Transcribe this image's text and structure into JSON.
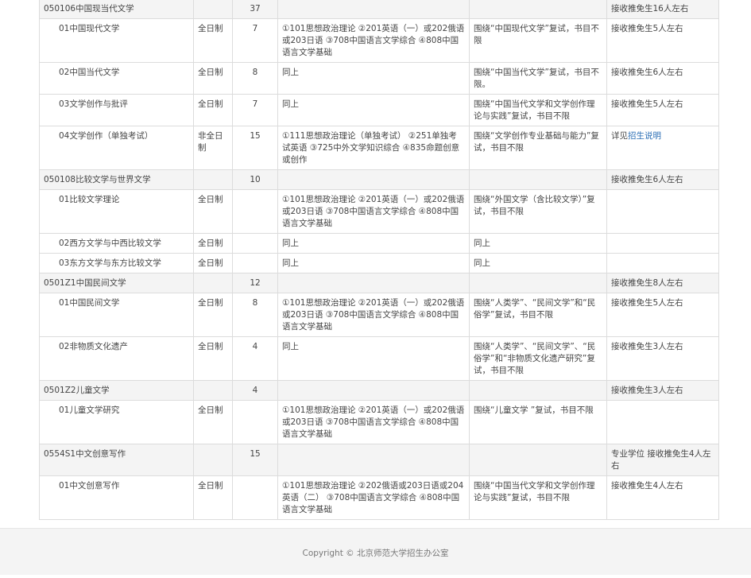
{
  "table": {
    "rows": [
      {
        "type": "major",
        "name": "050106中国现当代文学",
        "mode": "",
        "count": "37",
        "exam": "",
        "retest": "",
        "note": "接收推免生16人左右"
      },
      {
        "type": "dir",
        "name": "01中国现代文学",
        "mode": "全日制",
        "count": "7",
        "exam": "①101思想政治理论 ②201英语（一）或202俄语或203日语 ③708中国语言文学综合 ④808中国语言文学基础",
        "retest": "围绕“中国现代文学”复试，书目不限",
        "note": "接收推免生5人左右"
      },
      {
        "type": "dir",
        "name": "02中国当代文学",
        "mode": "全日制",
        "count": "8",
        "exam": "同上",
        "retest": "围绕“中国当代文学”复试，书目不限。",
        "note": "接收推免生6人左右"
      },
      {
        "type": "dir",
        "name": "03文学创作与批评",
        "mode": "全日制",
        "count": "7",
        "exam": "同上",
        "retest": "围绕“中国当代文学和文学创作理论与实践”复试，书目不限",
        "note": "接收推免生5人左右"
      },
      {
        "type": "dir",
        "name": "04文学创作（单独考试）",
        "mode": "非全日制",
        "count": "15",
        "exam": "①111思想政治理论（单独考试） ②251单独考试英语 ③725中外文学知识综合 ④835命题创意或创作",
        "retest": "围绕“文学创作专业基础与能力”复试，书目不限",
        "note": "",
        "note_prefix": "详见",
        "note_link": "招生说明"
      },
      {
        "type": "major",
        "name": "050108比较文学与世界文学",
        "mode": "",
        "count": "10",
        "exam": "",
        "retest": "",
        "note": "接收推免生6人左右"
      },
      {
        "type": "dir",
        "name": "01比较文学理论",
        "mode": "全日制",
        "count": "",
        "exam": "①101思想政治理论 ②201英语（一）或202俄语或203日语 ③708中国语言文学综合 ④808中国语言文学基础",
        "retest": "围绕“外国文学（含比较文学）”复试，书目不限",
        "note": ""
      },
      {
        "type": "dir",
        "name": "02西方文学与中西比较文学",
        "mode": "全日制",
        "count": "",
        "exam": "同上",
        "retest": "同上",
        "note": ""
      },
      {
        "type": "dir",
        "name": "03东方文学与东方比较文学",
        "mode": "全日制",
        "count": "",
        "exam": "同上",
        "retest": "同上",
        "note": ""
      },
      {
        "type": "major",
        "name": "0501Z1中国民间文学",
        "mode": "",
        "count": "12",
        "exam": "",
        "retest": "",
        "note": "接收推免生8人左右"
      },
      {
        "type": "dir",
        "name": "01中国民间文学",
        "mode": "全日制",
        "count": "8",
        "exam": "①101思想政治理论 ②201英语（一）或202俄语或203日语 ③708中国语言文学综合 ④808中国语言文学基础",
        "retest": "围绕“人类学”、“民间文学”和“民俗学”复试，书目不限",
        "note": "接收推免生5人左右"
      },
      {
        "type": "dir",
        "name": "02非物质文化遗产",
        "mode": "全日制",
        "count": "4",
        "exam": "同上",
        "retest": "围绕“人类学”、“民间文学”、“民俗学”和“非物质文化遗产研究”复试，书目不限",
        "note": "接收推免生3人左右"
      },
      {
        "type": "major",
        "name": "0501Z2儿童文学",
        "mode": "",
        "count": "4",
        "exam": "",
        "retest": "",
        "note": "接收推免生3人左右"
      },
      {
        "type": "dir",
        "name": "01儿童文学研究",
        "mode": "全日制",
        "count": "",
        "exam": "①101思想政治理论 ②201英语（一）或202俄语或203日语 ③708中国语言文学综合 ④808中国语言文学基础",
        "retest": "围绕“儿童文学 ”复试，书目不限",
        "note": ""
      },
      {
        "type": "major",
        "name": "0554S1中文创意写作",
        "mode": "",
        "count": "15",
        "exam": "",
        "retest": "",
        "note": "专业学位 接收推免生4人左右"
      },
      {
        "type": "dir",
        "name": "01中文创意写作",
        "mode": "全日制",
        "count": "",
        "exam": "①101思想政治理论 ②202俄语或203日语或204英语（二） ③708中国语言文学综合 ④808中国语言文学基础",
        "retest": "围绕“中国当代文学和文学创作理论与实践”复试，书目不限",
        "note": "接收推免生4人左右"
      }
    ]
  },
  "footer": {
    "copyright": "Copyright © 北京师范大学招生办公室"
  }
}
